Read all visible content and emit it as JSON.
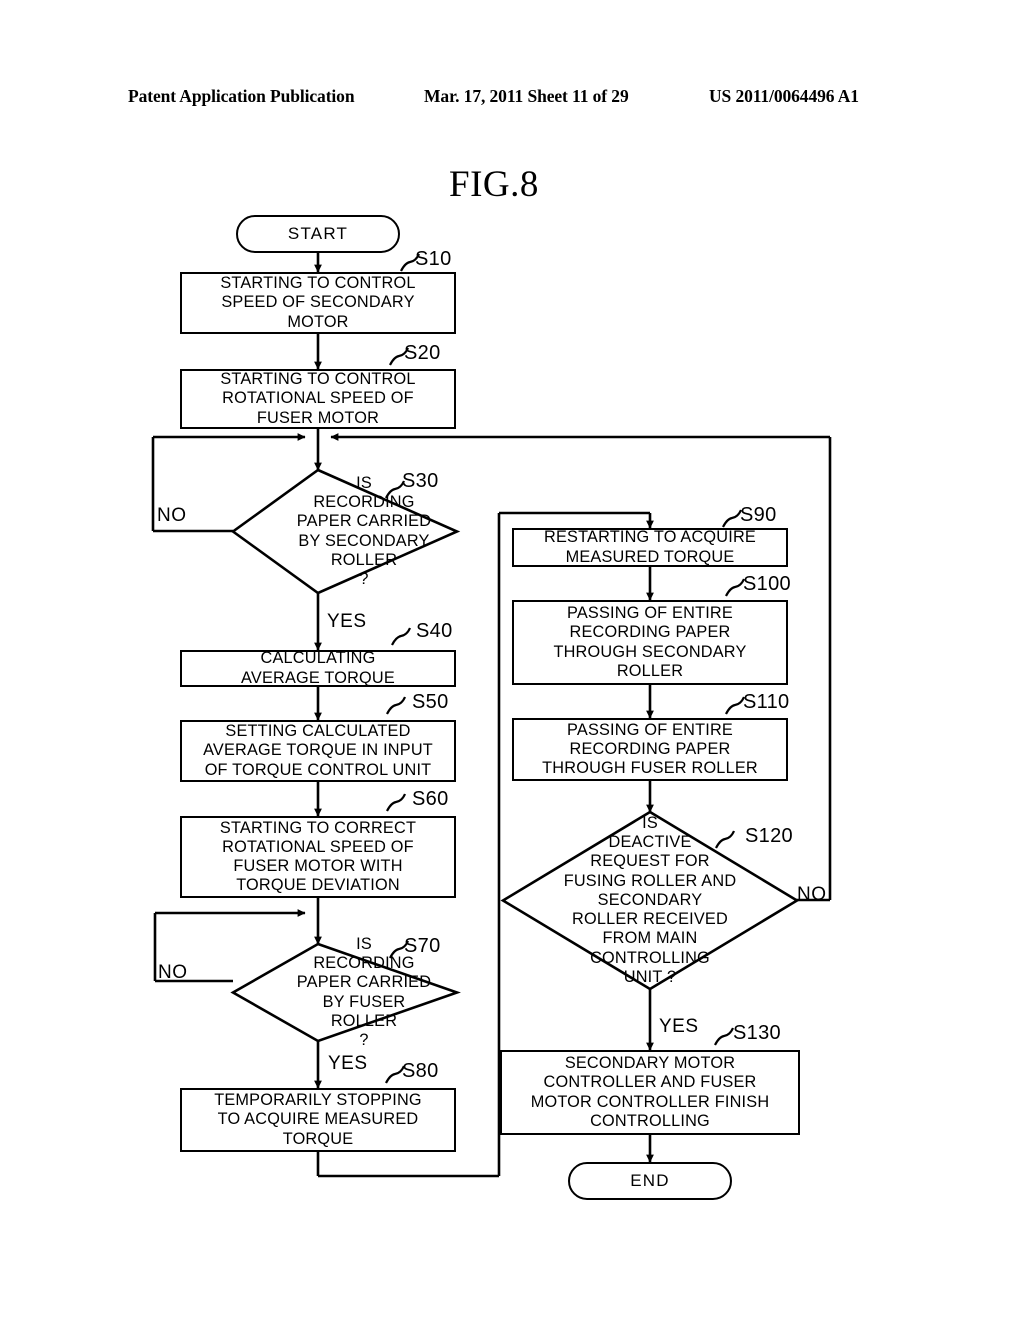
{
  "header": {
    "publication": "Patent Application Publication",
    "date_sheet": "Mar. 17, 2011  Sheet 11 of 29",
    "patent_number": "US 2011/0064496 A1"
  },
  "figure": {
    "label": "FIG.8"
  },
  "chart_data": {
    "type": "diagram",
    "title": "FIG.8",
    "diagram_kind": "flowchart",
    "nodes": [
      {
        "id": "start",
        "shape": "terminal",
        "text": "START"
      },
      {
        "id": "S10",
        "tag": "S10",
        "shape": "process",
        "text": "STARTING TO CONTROL\nSPEED OF SECONDARY\nMOTOR"
      },
      {
        "id": "S20",
        "tag": "S20",
        "shape": "process",
        "text": "STARTING TO CONTROL\nROTATIONAL SPEED OF\nFUSER MOTOR"
      },
      {
        "id": "S30",
        "tag": "S30",
        "shape": "decision",
        "text": "IS\nRECORDING\nPAPER CARRIED\nBY SECONDARY\nROLLER\n?"
      },
      {
        "id": "S40",
        "tag": "S40",
        "shape": "process",
        "text": "CALCULATING\nAVERAGE TORQUE"
      },
      {
        "id": "S50",
        "tag": "S50",
        "shape": "process",
        "text": "SETTING CALCULATED\nAVERAGE TORQUE IN INPUT\nOF TORQUE CONTROL UNIT"
      },
      {
        "id": "S60",
        "tag": "S60",
        "shape": "process",
        "text": "STARTING TO CORRECT\nROTATIONAL SPEED OF\nFUSER MOTOR WITH\nTORQUE DEVIATION"
      },
      {
        "id": "S70",
        "tag": "S70",
        "shape": "decision",
        "text": "IS\nRECORDING\nPAPER CARRIED\nBY FUSER\nROLLER\n?"
      },
      {
        "id": "S80",
        "tag": "S80",
        "shape": "process",
        "text": "TEMPORARILY STOPPING\nTO ACQUIRE MEASURED\nTORQUE"
      },
      {
        "id": "S90",
        "tag": "S90",
        "shape": "process",
        "text": "RESTARTING TO ACQUIRE\nMEASURED TORQUE"
      },
      {
        "id": "S100",
        "tag": "S100",
        "shape": "process",
        "text": "PASSING OF ENTIRE\nRECORDING PAPER\nTHROUGH SECONDARY\nROLLER"
      },
      {
        "id": "S110",
        "tag": "S110",
        "shape": "process",
        "text": "PASSING OF ENTIRE\nRECORDING PAPER\nTHROUGH FUSER ROLLER"
      },
      {
        "id": "S120",
        "tag": "S120",
        "shape": "decision",
        "text": "IS\nDEACTIVE\nREQUEST FOR\nFUSING ROLLER AND\nSECONDARY\nROLLER RECEIVED\nFROM MAIN\nCONTROLLING\nUNIT ?"
      },
      {
        "id": "S130",
        "tag": "S130",
        "shape": "process",
        "text": "SECONDARY MOTOR\nCONTROLLER AND FUSER\nMOTOR CONTROLLER FINISH\nCONTROLLING"
      },
      {
        "id": "end",
        "shape": "terminal",
        "text": "END"
      }
    ],
    "edges": [
      {
        "from": "start",
        "to": "S10",
        "label": ""
      },
      {
        "from": "S10",
        "to": "S20",
        "label": ""
      },
      {
        "from": "S20",
        "to": "S30",
        "label": ""
      },
      {
        "from": "S30",
        "to": "S40",
        "label": "YES"
      },
      {
        "from": "S30",
        "to": "S30",
        "label": "NO"
      },
      {
        "from": "S40",
        "to": "S50",
        "label": ""
      },
      {
        "from": "S50",
        "to": "S60",
        "label": ""
      },
      {
        "from": "S60",
        "to": "S70",
        "label": ""
      },
      {
        "from": "S70",
        "to": "S80",
        "label": "YES"
      },
      {
        "from": "S70",
        "to": "S70",
        "label": "NO"
      },
      {
        "from": "S80",
        "to": "S90",
        "label": ""
      },
      {
        "from": "S90",
        "to": "S100",
        "label": ""
      },
      {
        "from": "S100",
        "to": "S110",
        "label": ""
      },
      {
        "from": "S110",
        "to": "S120",
        "label": ""
      },
      {
        "from": "S120",
        "to": "S130",
        "label": "YES"
      },
      {
        "from": "S120",
        "to": "S30",
        "label": "NO"
      },
      {
        "from": "S130",
        "to": "end",
        "label": ""
      }
    ]
  },
  "nodes": {
    "start": {
      "text": "START"
    },
    "s10": {
      "tag": "S10",
      "text": "STARTING TO CONTROL\nSPEED OF SECONDARY\nMOTOR"
    },
    "s20": {
      "tag": "S20",
      "text": "STARTING TO CONTROL\nROTATIONAL SPEED OF\nFUSER MOTOR"
    },
    "s30": {
      "tag": "S30",
      "text": "IS\nRECORDING\nPAPER CARRIED\nBY SECONDARY\nROLLER\n?",
      "no": "NO",
      "yes": "YES"
    },
    "s40": {
      "tag": "S40",
      "text": "CALCULATING\nAVERAGE TORQUE"
    },
    "s50": {
      "tag": "S50",
      "text": "SETTING CALCULATED\nAVERAGE TORQUE IN INPUT\nOF TORQUE CONTROL UNIT"
    },
    "s60": {
      "tag": "S60",
      "text": "STARTING TO CORRECT\nROTATIONAL SPEED OF\nFUSER MOTOR WITH\nTORQUE DEVIATION"
    },
    "s70": {
      "tag": "S70",
      "text": "IS\nRECORDING\nPAPER CARRIED\nBY FUSER\nROLLER\n?",
      "no": "NO",
      "yes": "YES"
    },
    "s80": {
      "tag": "S80",
      "text": "TEMPORARILY STOPPING\nTO ACQUIRE MEASURED\nTORQUE"
    },
    "s90": {
      "tag": "S90",
      "text": "RESTARTING TO ACQUIRE\nMEASURED TORQUE"
    },
    "s100": {
      "tag": "S100",
      "text": "PASSING OF ENTIRE\nRECORDING PAPER\nTHROUGH SECONDARY\nROLLER"
    },
    "s110": {
      "tag": "S110",
      "text": "PASSING OF ENTIRE\nRECORDING PAPER\nTHROUGH FUSER ROLLER"
    },
    "s120": {
      "tag": "S120",
      "text": "IS\nDEACTIVE\nREQUEST FOR\nFUSING ROLLER AND\nSECONDARY\nROLLER RECEIVED\nFROM MAIN\nCONTROLLING\nUNIT ?",
      "no": "NO",
      "yes": "YES"
    },
    "s130": {
      "tag": "S130",
      "text": "SECONDARY MOTOR\nCONTROLLER AND FUSER\nMOTOR CONTROLLER FINISH\nCONTROLLING"
    },
    "end": {
      "text": "END"
    }
  }
}
